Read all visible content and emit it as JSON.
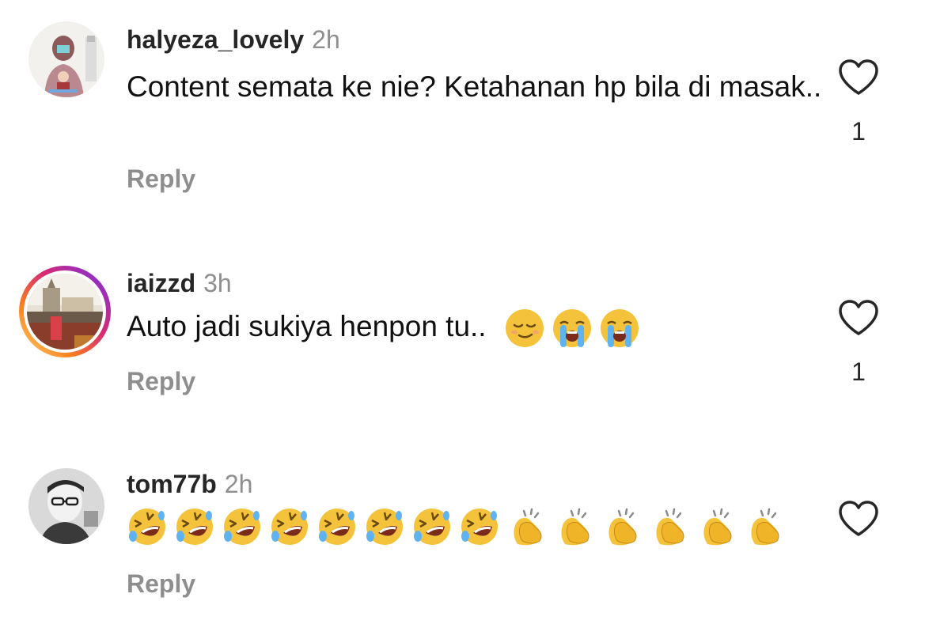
{
  "comments": [
    {
      "username": "halyeza_lovely",
      "time": "2h",
      "text": "Content semata ke nie? Ketahanan hp bila di masak..",
      "reply_label": "Reply",
      "like_count": "1",
      "avatar_icon": "avatar-photo-woman-hijab"
    },
    {
      "username": "iaizzd",
      "time": "3h",
      "text": "Auto jadi sukiya henpon tu..",
      "emojis": [
        "relieved-face-emoji",
        "loudly-crying-face-emoji",
        "loudly-crying-face-emoji"
      ],
      "reply_label": "Reply",
      "like_count": "1",
      "avatar_icon": "avatar-photo-building",
      "has_story_ring": true
    },
    {
      "username": "tom77b",
      "time": "2h",
      "emojis": [
        "rolling-laughing-emoji",
        "rolling-laughing-emoji",
        "rolling-laughing-emoji",
        "rolling-laughing-emoji",
        "rolling-laughing-emoji",
        "rolling-laughing-emoji",
        "rolling-laughing-emoji",
        "rolling-laughing-emoji",
        "clapping-hands-emoji",
        "clapping-hands-emoji",
        "clapping-hands-emoji",
        "clapping-hands-emoji",
        "clapping-hands-emoji",
        "clapping-hands-emoji"
      ],
      "reply_label": "Reply",
      "avatar_icon": "avatar-photo-man-glasses"
    }
  ],
  "colors": {
    "username": "#262626",
    "meta_gray": "#8e8e8e",
    "story_ring": "#d62976"
  },
  "icons": {
    "like": "heart-outline-icon"
  }
}
